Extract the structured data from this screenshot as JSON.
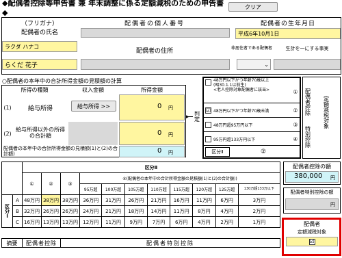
{
  "title": "◆配偶者控除等申告書 兼 年末調整に係る定額減税のための申告書◆",
  "clear_label": "クリア",
  "spouse": {
    "name_header_kana": "（フリガナ）",
    "name_header": "配偶者の氏名",
    "number_header": "配偶者の個人番号",
    "birth_header": "配偶者の生年月日",
    "birth_value": "平成6年10月1日",
    "kana_value": "ラクダ ハナコ",
    "name_value": "らくだ 花子",
    "address_header": "配偶者の住所",
    "nonresident_label": "非居住者である配偶者",
    "same_living_label": "生計を一にする事実"
  },
  "calc": {
    "section_title": "○配偶者の本年中の合計所得金額の見積額の計算",
    "type_header": "所得の種類",
    "income_header": "収入金額",
    "amount_header": "所得金額",
    "row1_num": "(1)",
    "row1_label": "給与所得",
    "salary_button": "給与所得 >>",
    "row1_value": "0",
    "row2_num": "(2)",
    "row2_label": "給与所得以外の所得の合計額",
    "row2_value": "0",
    "total_label": "配偶者の本年中の合計所得金額の見積額(1)と(2)の合計額)",
    "total_value": "0",
    "yen": "円"
  },
  "judge": {
    "label": "判定",
    "opt1": "48万円以下かつ年齢70歳以上",
    "opt1b": "(昭30.1.1以前生)",
    "opt1c": "<老人控除対象配偶者に該当>",
    "opt2": "48万円以下かつ年齢70歳未満",
    "opt3": "48万円超95万円以下",
    "opt4": "95万円超133万円以下",
    "mark_1": "①",
    "mark_2": "②",
    "mark_3": "③",
    "mark_4": "④",
    "side1": "配偶者控除",
    "side2": "特別控除",
    "side3": "定額減税対象",
    "kubun_label": "区分Ⅱ",
    "kubun_value": "②"
  },
  "kubun2": {
    "header": "区分Ⅱ",
    "c1": "①",
    "c2": "②",
    "c3": "③",
    "c4_title": "④(配偶者の本年中の合計所得金額の見積額(1)と(2)の合計額))",
    "sub_headers": [
      "95万超",
      "100万超",
      "105万超",
      "110万超",
      "115万超",
      "120万超",
      "125万超",
      "130万超133万以下"
    ],
    "row_header": "区分Ⅰ",
    "rows": [
      {
        "label": "A",
        "values": [
          "48万円",
          "38万円",
          "38万円",
          "36万円",
          "31万円",
          "26万円",
          "21万円",
          "16万円",
          "11万円",
          "6万円",
          "3万円"
        ]
      },
      {
        "label": "B",
        "values": [
          "32万円",
          "26万円",
          "26万円",
          "24万円",
          "21万円",
          "18万円",
          "14万円",
          "11万円",
          "8万円",
          "4万円",
          "2万円"
        ]
      },
      {
        "label": "C",
        "values": [
          "16万円",
          "13万円",
          "13万円",
          "12万円",
          "11万円",
          "9万円",
          "7万円",
          "6万円",
          "4万円",
          "2万円",
          "1万円"
        ]
      }
    ],
    "footer_left": "摘要",
    "footer_mid": "配偶者控除",
    "footer_right": "配偶者特別控除"
  },
  "results": {
    "deduction_label": "配偶者控除の額",
    "deduction_value": "380,000",
    "deduction_unit": "円",
    "special_label": "配偶者特別控除の額",
    "special_unit": "円",
    "target_label1": "配偶者",
    "target_label2": "定額減税対象",
    "target_check": "☑"
  }
}
